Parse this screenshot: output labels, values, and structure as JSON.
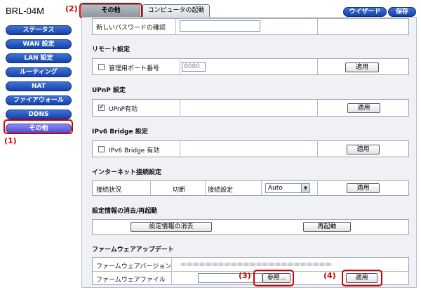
{
  "model": "BRL-04M",
  "callouts": {
    "c1": "(1)",
    "c2": "(2)",
    "c3": "(3)",
    "c4": "(4)"
  },
  "sidebar": {
    "items": [
      {
        "label": "ステータス"
      },
      {
        "label": "WAN 設定"
      },
      {
        "label": "LAN 設定"
      },
      {
        "label": "ルーティング"
      },
      {
        "label": "NAT"
      },
      {
        "label": "ファイアウォール"
      },
      {
        "label": "DDNS"
      },
      {
        "label": "その他",
        "active": true
      }
    ]
  },
  "tabs": {
    "other": "その他",
    "boot": "コンピュータの起動"
  },
  "top_buttons": {
    "wizard": "ウイザード",
    "save": "保存"
  },
  "password_confirm": {
    "label": "新しいパスワードの確認",
    "value": ""
  },
  "remote": {
    "title": "リモート設定",
    "port_label": "管理用ポート番号",
    "port_value": "8080",
    "checked": false,
    "apply": "適用"
  },
  "upnp": {
    "title": "UPnP 設定",
    "label": "UPnP有効",
    "checked": true,
    "apply": "適用"
  },
  "ipv6": {
    "title": "IPv6 Bridge 設定",
    "label": "IPv6 Bridge 有効",
    "checked": false,
    "apply": "適用"
  },
  "internet": {
    "title": "インターネット接続設定",
    "status_label": "接続状況",
    "status_value": "切断",
    "setting_label": "接続設定",
    "setting_value": "Auto",
    "apply": "適用"
  },
  "reset": {
    "title": "設定情報の消去/再起動",
    "clear": "設定情報の消去",
    "reboot": "再起動"
  },
  "firmware": {
    "title": "ファームウェアアップデート",
    "version_label": "ファームウェアバージョン",
    "file_label": "ファームウェアファイル",
    "browse": "参照...",
    "apply": "適用"
  }
}
